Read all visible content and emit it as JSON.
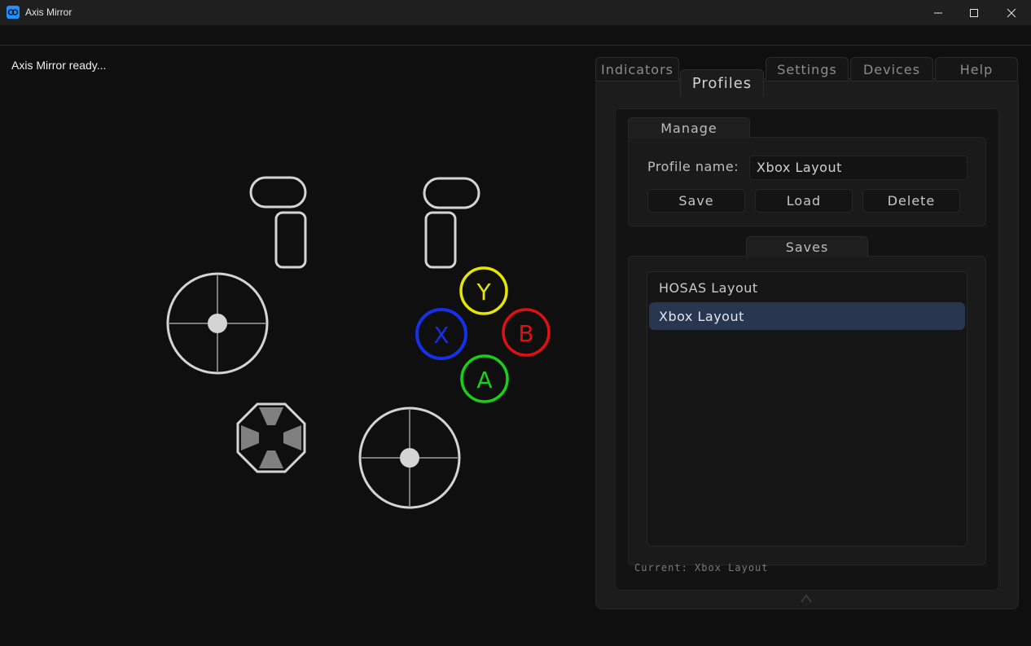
{
  "window": {
    "title": "Axis Mirror",
    "controls": [
      "minimize",
      "maximize",
      "close"
    ]
  },
  "status": {
    "text": "Axis Mirror ready..."
  },
  "controller": {
    "face_buttons": [
      {
        "label": "Y",
        "color": "#e6e600"
      },
      {
        "label": "B",
        "color": "#e01010"
      },
      {
        "label": "X",
        "color": "#1530e8"
      },
      {
        "label": "A",
        "color": "#18d018"
      }
    ],
    "outline_color": "#d4d4d4",
    "dpad_segment_color": "#808080"
  },
  "tabs": [
    {
      "label": "Indicators",
      "active": false
    },
    {
      "label": "Profiles",
      "active": true
    },
    {
      "label": "Settings",
      "active": false
    },
    {
      "label": "Devices",
      "active": false
    },
    {
      "label": "Help",
      "active": false
    }
  ],
  "manage": {
    "group_label": "Manage",
    "profile_name_label": "Profile name:",
    "profile_name_value": "Xbox Layout",
    "save_label": "Save",
    "load_label": "Load",
    "delete_label": "Delete"
  },
  "saves": {
    "group_label": "Saves",
    "items": [
      {
        "label": "HOSAS Layout",
        "selected": false
      },
      {
        "label": "Xbox Layout",
        "selected": true
      }
    ]
  },
  "current": {
    "text": "Current: Xbox Layout"
  },
  "colors": {
    "accent": "#283650",
    "background": "#0f0f0f"
  }
}
